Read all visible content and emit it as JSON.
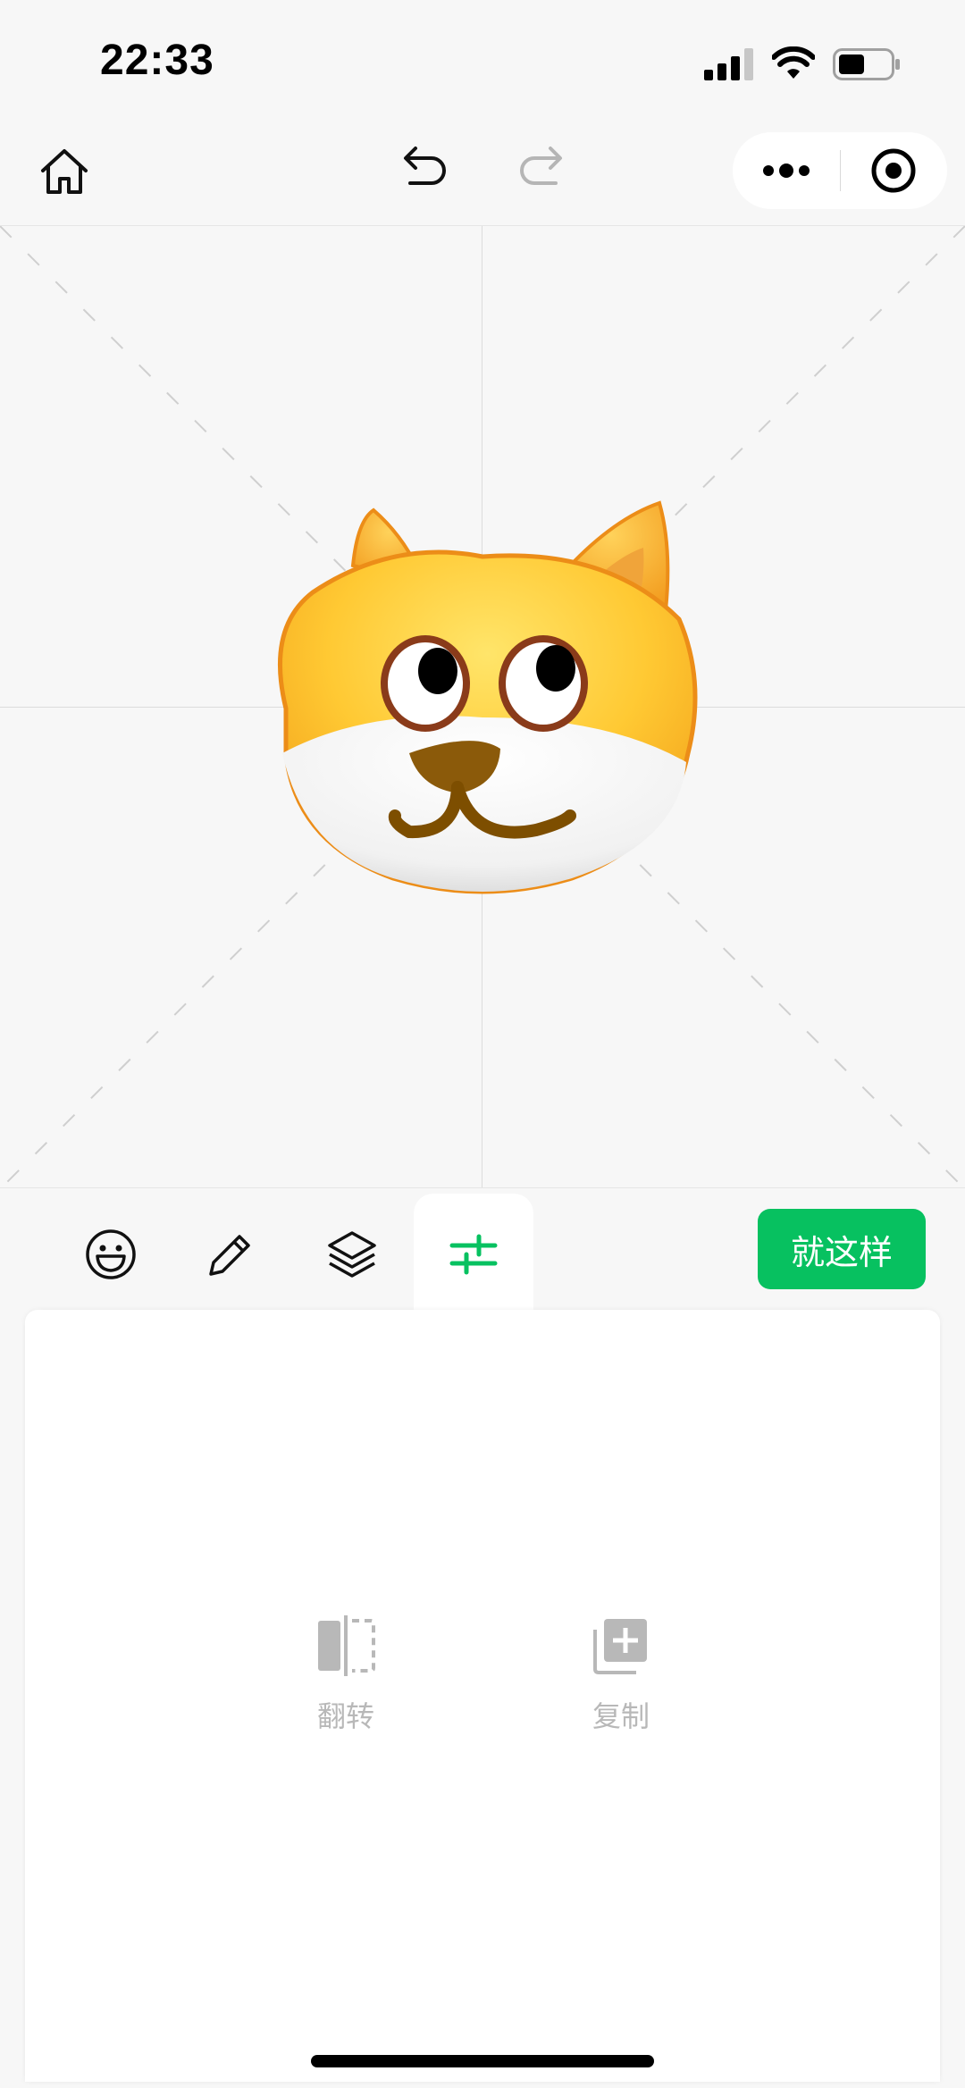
{
  "status_bar": {
    "time": "22:33"
  },
  "nav": {
    "home_icon": "home-icon",
    "undo_icon": "undo-icon",
    "redo_icon": "redo-icon",
    "more_icon": "more-dots-icon",
    "record_icon": "target-icon"
  },
  "canvas": {
    "sticker": "dog-face-emoji"
  },
  "toolbar": {
    "tools": [
      "emoji-icon",
      "pencil-icon",
      "layers-icon",
      "sliders-icon"
    ],
    "active_tool": "sliders-icon",
    "confirm_label": "就这样"
  },
  "panel": {
    "actions": [
      {
        "label": "翻转",
        "icon": "flip-icon"
      },
      {
        "label": "复制",
        "icon": "copy-icon"
      }
    ]
  },
  "colors": {
    "accent": "#07c160",
    "disabled": "#b8b8b8"
  }
}
